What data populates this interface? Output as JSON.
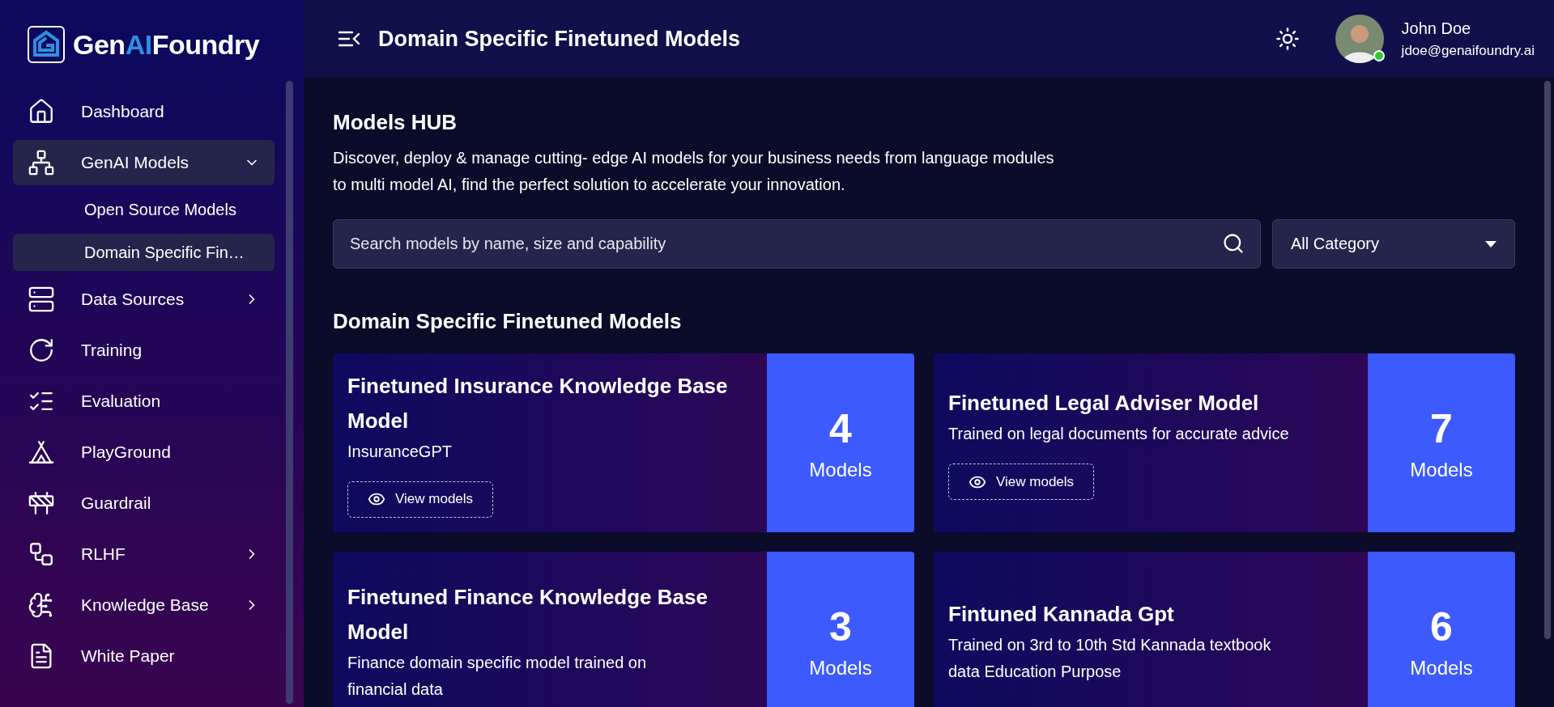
{
  "brand": {
    "prefix": "Gen",
    "accent": "AI",
    "suffix": "Foundry"
  },
  "sidebar": {
    "items": [
      {
        "label": "Dashboard",
        "selected": false
      },
      {
        "label": "GenAI Models",
        "selected": true,
        "expanded": true,
        "children": [
          {
            "label": "Open Source Models",
            "selected": false
          },
          {
            "label": "Domain Specific Fin…",
            "selected": true
          }
        ]
      },
      {
        "label": "Data Sources",
        "selected": false,
        "expanded": false
      },
      {
        "label": "Training",
        "selected": false
      },
      {
        "label": "Evaluation",
        "selected": false
      },
      {
        "label": "PlayGround",
        "selected": false
      },
      {
        "label": "Guardrail",
        "selected": false
      },
      {
        "label": "RLHF",
        "selected": false,
        "expanded": false
      },
      {
        "label": "Knowledge Base",
        "selected": false,
        "expanded": false
      },
      {
        "label": "White Paper",
        "selected": false
      }
    ]
  },
  "header": {
    "title": "Domain Specific Finetuned Models",
    "user": {
      "name": "John Doe",
      "email": "jdoe@genaifoundry.ai",
      "online": true
    }
  },
  "hub": {
    "title": "Models HUB",
    "description": "Discover, deploy & manage cutting- edge AI models for your business needs from language modules to multi model AI, find the perfect solution to accelerate your innovation.",
    "search": {
      "placeholder": "Search models by name, size and capability"
    },
    "category": {
      "value": "All Category"
    }
  },
  "section": {
    "title": "Domain Specific Finetuned Models",
    "cards": [
      {
        "title": "Finetuned Insurance Knowledge Base Model",
        "description": "InsuranceGPT",
        "count": "4",
        "unit": "Models",
        "button": "View models"
      },
      {
        "title": "Finetuned Legal Adviser Model",
        "description": "Trained on legal documents for accurate advice",
        "count": "7",
        "unit": "Models",
        "button": "View models"
      },
      {
        "title": "Finetuned Finance Knowledge Base Model",
        "description": "Finance domain specific model trained on financial data",
        "count": "3",
        "unit": "Models"
      },
      {
        "title": "Fintuned Kannada Gpt",
        "description": "Trained on 3rd to 10th Std Kannada textbook data Education Purpose",
        "count": "6",
        "unit": "Models"
      }
    ]
  }
}
